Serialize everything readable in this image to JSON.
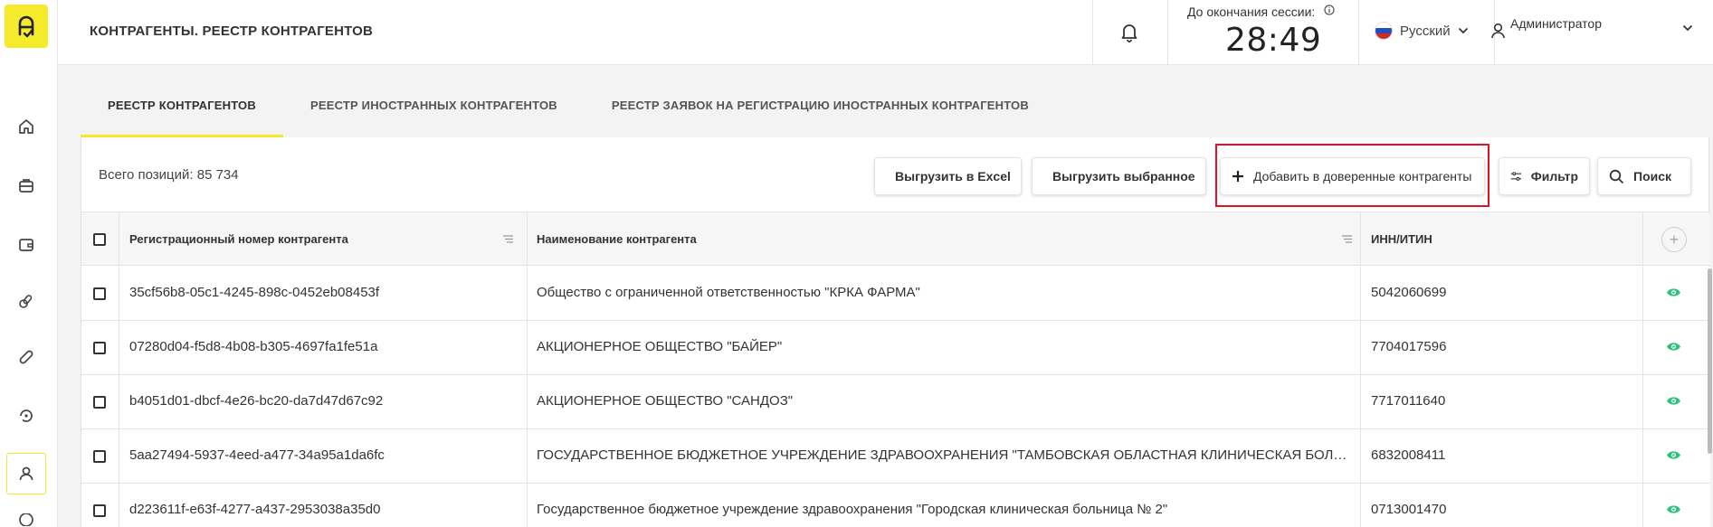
{
  "header": {
    "title": "КОНТРАГЕНТЫ. РЕЕСТР КОНТРАГЕНТОВ",
    "session_label": "До окончания сессии:",
    "session_time": "28:49",
    "language": "Русский",
    "user_name": "Администратор"
  },
  "sidebar": {
    "items": [
      {
        "icon": "home-icon"
      },
      {
        "icon": "briefcase-icon"
      },
      {
        "icon": "wallet-icon"
      },
      {
        "icon": "pills-icon"
      },
      {
        "icon": "capsule-icon"
      },
      {
        "icon": "refresh-icon"
      },
      {
        "icon": "user-icon",
        "active": true
      }
    ]
  },
  "tabs": [
    {
      "label": "РЕЕСТР КОНТРАГЕНТОВ",
      "active": true
    },
    {
      "label": "РЕЕСТР ИНОСТРАННЫХ КОНТРАГЕНТОВ",
      "active": false
    },
    {
      "label": "РЕЕСТР ЗАЯВОК НА РЕГИСТРАЦИЮ ИНОСТРАННЫХ КОНТРАГЕНТОВ",
      "active": false
    }
  ],
  "toolbar": {
    "total": "Всего позиций: 85 734",
    "export_excel": "Выгрузить в Excel",
    "export_selected": "Выгрузить выбранное",
    "add_trusted": "Добавить в доверенные контрагенты",
    "filter": "Фильтр",
    "search": "Поиск"
  },
  "table": {
    "columns": [
      "Регистрационный номер контрагента",
      "Наименование контрагента",
      "ИНН/ИТИН"
    ],
    "rows": [
      {
        "reg": "35cf56b8-05c1-4245-898c-0452eb08453f",
        "name": "Общество с ограниченной ответственностью \"КРКА ФАРМА\"",
        "inn": "5042060699"
      },
      {
        "reg": "07280d04-f5d8-4b08-b305-4697fa1fe51a",
        "name": "АКЦИОНЕРНОЕ ОБЩЕСТВО \"БАЙЕР\"",
        "inn": "7704017596"
      },
      {
        "reg": "b4051d01-dbcf-4e26-bc20-da7d47d67c92",
        "name": "АКЦИОНЕРНОЕ ОБЩЕСТВО \"САНДОЗ\"",
        "inn": "7717011640"
      },
      {
        "reg": "5aa27494-5937-4eed-a477-34a95a1da6fc",
        "name": "ГОСУДАРСТВЕННОЕ БЮДЖЕТНОЕ УЧРЕЖДЕНИЕ ЗДРАВООХРАНЕНИЯ \"ТАМБОВСКАЯ ОБЛАСТНАЯ КЛИНИЧЕСКАЯ БОЛЬНИЦА ...",
        "inn": "6832008411"
      },
      {
        "reg": "d223611f-e63f-4277-a437-2953038a35d0",
        "name": "Государственное бюджетное учреждение здравоохранения \"Городская клиническая больница № 2\"",
        "inn": "0713001470"
      }
    ]
  },
  "colors": {
    "accent": "#f5ea2b",
    "highlight": "#e0121c",
    "eye": "#2ec27e"
  }
}
